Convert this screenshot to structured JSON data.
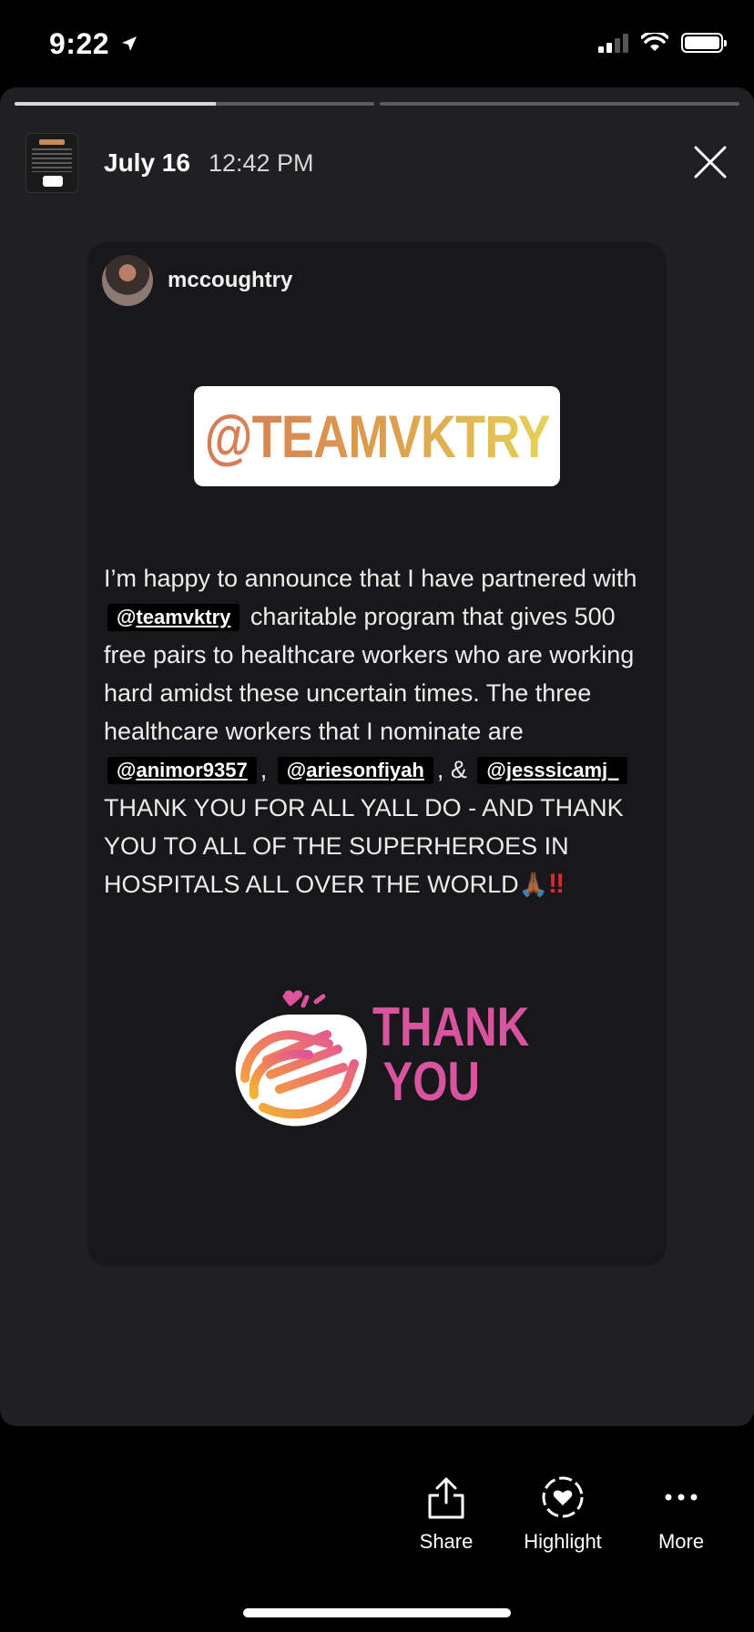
{
  "status_bar": {
    "time": "9:22"
  },
  "story": {
    "progress": [
      0.56,
      0
    ],
    "date": "July 16",
    "time": "12:42 PM"
  },
  "post": {
    "username": "mccoughtry",
    "tag_sticker": "@TEAMVKTRY",
    "caption": {
      "p1": "I’m happy to announce that I have partnered with",
      "mention1": "teamvktry",
      "p2": "charitable program that gives 500 free pairs to healthcare workers who are working hard amidst these uncertain times. The three healthcare workers that I nominate are",
      "mention2": "animor9357",
      "sep1": ",",
      "mention3": "ariesonfiyah",
      "sep2": ", &",
      "mention4": "jesssicamj_",
      "p3": "THANK YOU FOR ALL YALL DO - AND THANK YOU TO ALL OF THE SUPERHEROES IN HOSPITALS ALL OVER THE WORLD",
      "at": "@",
      "emoji_pray": "🙏🏾",
      "emoji_bang": "‼"
    },
    "thank_sticker": {
      "line1": "THANK",
      "line2": "YOU"
    }
  },
  "actions": {
    "share": "Share",
    "highlight": "Highlight",
    "more": "More"
  },
  "colors": {
    "tag_gradient_start": "#d47b56",
    "tag_gradient_end": "#e6d25a",
    "thank_pink": "#d9549f",
    "alert_red": "#e0262b"
  }
}
